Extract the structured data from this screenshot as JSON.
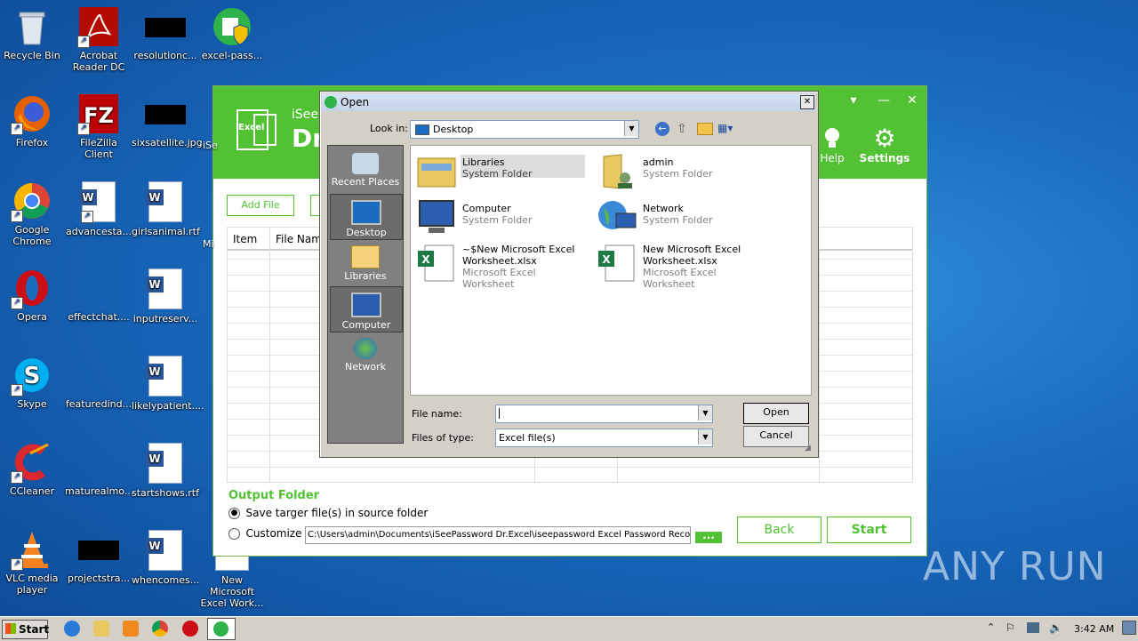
{
  "desktop": {
    "icons": [
      {
        "label": "Recycle Bin"
      },
      {
        "label": "Acrobat Reader DC"
      },
      {
        "label": "resolutionc..."
      },
      {
        "label": "excel-pass..."
      },
      {
        "label": "Firefox"
      },
      {
        "label": "FileZilla Client"
      },
      {
        "label": "sixsatellite.jpg"
      },
      {
        "label": "Google Chrome"
      },
      {
        "label": "advancesta..."
      },
      {
        "label": "girlsanimal.rtf"
      },
      {
        "label": "Opera"
      },
      {
        "label": "effectchat...."
      },
      {
        "label": "inputreserv..."
      },
      {
        "label": "Skype"
      },
      {
        "label": "featuredind..."
      },
      {
        "label": "likelypatient...."
      },
      {
        "label": "CCleaner"
      },
      {
        "label": "maturealmo..."
      },
      {
        "label": "startshows.rtf"
      },
      {
        "label": "VLC media player"
      },
      {
        "label": "projectstra..."
      },
      {
        "label": "whencomes..."
      },
      {
        "label": "New Microsoft Excel Work..."
      }
    ],
    "partial_labels": [
      "iSe",
      "Mi"
    ]
  },
  "app": {
    "logo_text": "Excel",
    "brand": "iSee",
    "title_partial": "Dr",
    "help_label": "Help",
    "settings_label": "Settings",
    "add_file_label": "Add File",
    "columns": [
      "Item",
      "File Nam"
    ],
    "output_folder_title": "Output Folder",
    "option_source": "Save targer file(s) in source folder",
    "option_customize": "Customize",
    "path_value": "C:\\Users\\admin\\Documents\\iSeePassword Dr.Excel\\iseepassword Excel Password Recove",
    "browse_label": "...",
    "back_label": "Back",
    "start_label": "Start"
  },
  "dialog": {
    "title": "Open",
    "look_in_label": "Look in:",
    "look_in_value": "Desktop",
    "places": [
      {
        "label": "Recent Places"
      },
      {
        "label": "Desktop"
      },
      {
        "label": "Libraries"
      },
      {
        "label": "Computer"
      },
      {
        "label": "Network"
      }
    ],
    "files": [
      {
        "name": "Libraries",
        "type": "System Folder"
      },
      {
        "name": "admin",
        "type": "System Folder"
      },
      {
        "name": "Computer",
        "type": "System Folder"
      },
      {
        "name": "Network",
        "type": "System Folder"
      },
      {
        "name": "~$New Microsoft Excel Worksheet.xlsx",
        "type": "Microsoft Excel Worksheet"
      },
      {
        "name": "New Microsoft Excel Worksheet.xlsx",
        "type": "Microsoft Excel Worksheet"
      }
    ],
    "file_name_label": "File name:",
    "file_name_value": "",
    "files_of_type_label": "Files of type:",
    "files_of_type_value": "Excel file(s)",
    "open_label": "Open",
    "cancel_label": "Cancel"
  },
  "taskbar": {
    "start_label": "Start",
    "clock": "3:42 AM"
  },
  "watermark": "ANY RUN"
}
